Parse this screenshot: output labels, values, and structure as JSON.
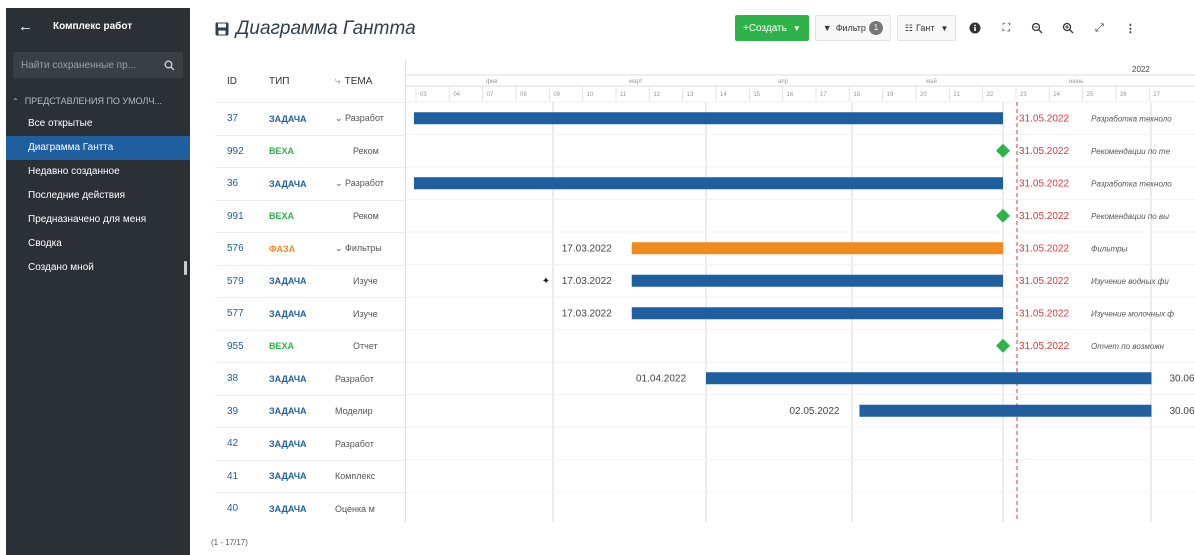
{
  "sidebar": {
    "title": "Комплекс работ",
    "search_placeholder": "Найти сохраненные пр...",
    "section_label": "ПРЕДСТАВЛЕНИЯ ПО УМОЛЧ...",
    "items": [
      {
        "label": "Все открытые",
        "active": false
      },
      {
        "label": "Диаграмма Гантта",
        "active": true
      },
      {
        "label": "Недавно созданное",
        "active": false
      },
      {
        "label": "Последние действия",
        "active": false
      },
      {
        "label": "Предназначено для меня",
        "active": false
      },
      {
        "label": "Сводка",
        "active": false
      },
      {
        "label": "Создано мной",
        "active": false
      }
    ]
  },
  "header": {
    "title": "Диаграмма Гантта",
    "create_label": "+Создать",
    "filter_label": "Фильтр",
    "filter_count": "1",
    "gantt_label": "Гант"
  },
  "grid": {
    "columns": {
      "id": "ID",
      "type": "ТИП",
      "topic": "ТЕМА"
    },
    "rows": [
      {
        "id": "37",
        "type": "ЗАДАЧА",
        "kind": "task",
        "expand": true,
        "topic": "Разработ"
      },
      {
        "id": "992",
        "type": "ВЕХА",
        "kind": "ms",
        "expand": false,
        "topic": "Реком"
      },
      {
        "id": "36",
        "type": "ЗАДАЧА",
        "kind": "task",
        "expand": true,
        "topic": "Разработ"
      },
      {
        "id": "991",
        "type": "ВЕХА",
        "kind": "ms",
        "expand": false,
        "topic": "Реком"
      },
      {
        "id": "576",
        "type": "ФАЗА",
        "kind": "phase",
        "expand": true,
        "topic": "Фильтры"
      },
      {
        "id": "579",
        "type": "ЗАДАЧА",
        "kind": "task",
        "expand": false,
        "topic": "Изуче"
      },
      {
        "id": "577",
        "type": "ЗАДАЧА",
        "kind": "task",
        "expand": false,
        "topic": "Изуче"
      },
      {
        "id": "955",
        "type": "ВЕХА",
        "kind": "ms",
        "expand": false,
        "topic": "Отчет"
      },
      {
        "id": "38",
        "type": "ЗАДАЧА",
        "kind": "task",
        "expand": false,
        "topic": "Разработ"
      },
      {
        "id": "39",
        "type": "ЗАДАЧА",
        "kind": "task",
        "expand": false,
        "topic": "Моделир"
      },
      {
        "id": "42",
        "type": "ЗАДАЧА",
        "kind": "task",
        "expand": false,
        "topic": "Разработ"
      },
      {
        "id": "41",
        "type": "ЗАДАЧА",
        "kind": "task",
        "expand": false,
        "topic": "Комплекс"
      },
      {
        "id": "40",
        "type": "ЗАДАЧА",
        "kind": "task",
        "expand": false,
        "topic": "Оценка м"
      }
    ],
    "footer": "(1 - 17/17)"
  },
  "gantt": {
    "year_label": "2022",
    "month_labels": [
      "фев",
      "март",
      "апр",
      "май",
      "июнь"
    ],
    "tick_labels": [
      "03",
      "04",
      "07",
      "08",
      "09",
      "10",
      "11",
      "12",
      "13",
      "14",
      "15",
      "16",
      "17",
      "18",
      "19",
      "20",
      "21",
      "22",
      "23",
      "24",
      "25",
      "26",
      "27"
    ],
    "today_date": "31.05.2022",
    "bars": [
      {
        "row": 0,
        "kind": "task",
        "start": "01.02.2022",
        "end": "31.05.2022",
        "end_label": "31.05.2022",
        "note": "Разработка техноло"
      },
      {
        "row": 1,
        "kind": "ms",
        "date": "31.05.2022",
        "end_label": "31.05.2022",
        "note": "Рекомендации по те"
      },
      {
        "row": 2,
        "kind": "task",
        "start": "01.02.2022",
        "end": "31.05.2022",
        "end_label": "31.05.2022",
        "note": "Разработка техноло"
      },
      {
        "row": 3,
        "kind": "ms",
        "date": "31.05.2022",
        "end_label": "31.05.2022",
        "note": "Рекомендации по вы"
      },
      {
        "row": 4,
        "kind": "phase",
        "start": "17.03.2022",
        "end": "31.05.2022",
        "start_label": "17.03.2022",
        "end_label": "31.05.2022",
        "note": "Фильтры"
      },
      {
        "row": 5,
        "kind": "task",
        "start": "17.03.2022",
        "end": "31.05.2022",
        "start_label": "17.03.2022",
        "end_label": "31.05.2022",
        "note": "Изучение водных фи",
        "pinned": true
      },
      {
        "row": 6,
        "kind": "task",
        "start": "17.03.2022",
        "end": "31.05.2022",
        "start_label": "17.03.2022",
        "end_label": "31.05.2022",
        "note": "Изучение молочных ф"
      },
      {
        "row": 7,
        "kind": "ms",
        "date": "31.05.2022",
        "end_label": "31.05.2022",
        "note": "Отчет по возможн"
      },
      {
        "row": 8,
        "kind": "task",
        "start": "01.04.2022",
        "end": "30.06.2022",
        "start_label": "01.04.2022",
        "end_label": "30.06"
      },
      {
        "row": 9,
        "kind": "task",
        "start": "02.05.2022",
        "end": "30.06.2022",
        "start_label": "02.05.2022",
        "end_label": "30.06"
      }
    ],
    "colors": {
      "task": "#1f5fa0",
      "phase": "#f08c1e",
      "milestone": "#2eb34a",
      "today": "#e0383b"
    }
  }
}
